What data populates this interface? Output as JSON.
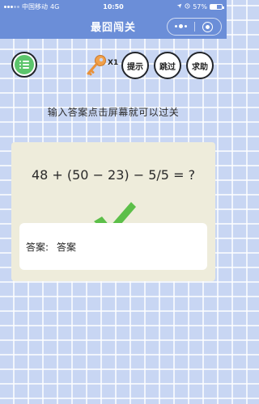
{
  "status_bar": {
    "carrier": "中国移动",
    "network": "4G",
    "time": "10:50",
    "battery": "57%"
  },
  "nav": {
    "title": "最囧闯关"
  },
  "toolbar": {
    "key_count": "X1",
    "hint_label": "提示",
    "skip_label": "跳过",
    "help_label": "求助"
  },
  "instruction": "输入答案点击屏幕就可以过关",
  "question": {
    "equation": "48 + (50 − 23) − 5/5 = ?",
    "answer_label": "答案:",
    "answer_value": "答案"
  },
  "colors": {
    "bar_blue": "#6b8ed8",
    "menu_green": "#5cc56c",
    "check_green": "#5cbf49",
    "key_orange": "#f0a04a",
    "card_bg": "#eeecdb"
  },
  "icons": {
    "menu": "menu-icon",
    "key": "key-icon",
    "check": "check-icon",
    "capsule_more": "more-icon",
    "capsule_close": "target-icon"
  }
}
